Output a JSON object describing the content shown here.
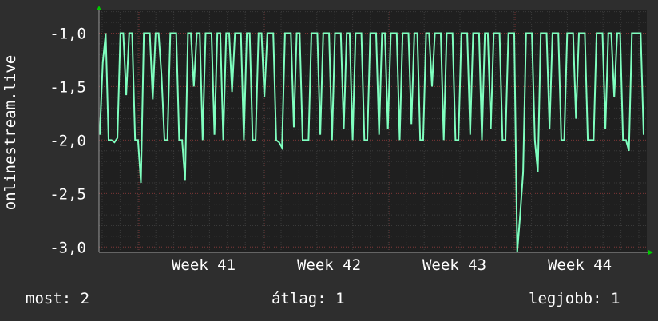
{
  "chart_data": {
    "type": "line",
    "ylabel": "onlinestream.live",
    "ylim": [
      -3.05,
      -0.78
    ],
    "yticks": [
      -1.0,
      -1.5,
      -2.0,
      -2.5,
      -3.0
    ],
    "ytick_labels": [
      "-1,0",
      "-1,5",
      "-2,0",
      "-2,5",
      "-3,0"
    ],
    "xtick_labels": [
      "Week 41",
      "Week 42",
      "Week 43",
      "Week 44"
    ],
    "grid": true,
    "colors": {
      "background": "#2e2e2e",
      "plot_background": "#1f1f1f",
      "line": "#7fffbf",
      "grid_minor": "#3a3a3a",
      "grid_major": "#7a3333",
      "axis": "#999999",
      "arrow": "#00cc00"
    },
    "series": [
      {
        "values": [
          -1.95,
          -1.28,
          -1.0,
          -2.0,
          -2.0,
          -2.02,
          -1.98,
          -1.0,
          -1.0,
          -1.58,
          -1.0,
          -1.0,
          -2.0,
          -2.0,
          -2.4,
          -1.0,
          -1.0,
          -1.0,
          -1.62,
          -1.0,
          -1.0,
          -1.4,
          -2.0,
          -2.0,
          -1.0,
          -1.0,
          -1.0,
          -2.0,
          -2.0,
          -2.38,
          -1.0,
          -1.0,
          -1.5,
          -1.0,
          -1.0,
          -2.0,
          -1.0,
          -1.0,
          -1.0,
          -1.95,
          -1.0,
          -1.0,
          -2.0,
          -1.0,
          -1.0,
          -1.55,
          -1.0,
          -1.0,
          -1.0,
          -2.0,
          -1.0,
          -1.0,
          -2.0,
          -2.0,
          -1.0,
          -1.0,
          -1.6,
          -1.0,
          -1.0,
          -1.0,
          -2.0,
          -2.02,
          -2.07,
          -1.0,
          -1.0,
          -1.0,
          -1.88,
          -1.0,
          -1.0,
          -2.0,
          -2.0,
          -2.0,
          -1.0,
          -1.0,
          -1.0,
          -1.95,
          -1.0,
          -1.0,
          -1.0,
          -2.0,
          -1.0,
          -1.0,
          -1.0,
          -1.9,
          -1.0,
          -1.0,
          -2.0,
          -1.0,
          -1.0,
          -1.0,
          -2.0,
          -2.0,
          -1.0,
          -1.0,
          -1.0,
          -1.95,
          -1.0,
          -1.0,
          -1.9,
          -1.0,
          -1.0,
          -1.0,
          -2.0,
          -1.0,
          -1.0,
          -1.0,
          -1.85,
          -1.0,
          -1.0,
          -2.0,
          -2.0,
          -1.0,
          -1.0,
          -1.5,
          -1.0,
          -1.0,
          -1.0,
          -2.0,
          -1.0,
          -1.0,
          -1.0,
          -2.0,
          -2.0,
          -1.0,
          -1.0,
          -1.0,
          -1.95,
          -1.0,
          -1.0,
          -1.0,
          -2.0,
          -1.0,
          -1.0,
          -1.9,
          -1.0,
          -1.0,
          -1.0,
          -2.0,
          -2.0,
          -1.0,
          -1.0,
          -1.0,
          -3.05,
          -2.7,
          -2.3,
          -1.0,
          -1.0,
          -1.0,
          -2.0,
          -2.3,
          -1.0,
          -1.0,
          -1.0,
          -1.9,
          -1.0,
          -1.0,
          -1.0,
          -2.0,
          -2.0,
          -1.0,
          -1.0,
          -1.0,
          -1.8,
          -1.0,
          -1.0,
          -1.0,
          -2.0,
          -2.0,
          -2.0,
          -1.0,
          -1.0,
          -1.0,
          -1.9,
          -1.0,
          -1.0,
          -1.6,
          -1.0,
          -1.0,
          -2.0,
          -2.0,
          -2.1,
          -1.0,
          -1.0,
          -1.0,
          -1.0,
          -1.95
        ]
      }
    ]
  },
  "legend": {
    "now": "most: 2",
    "avg": "átlag: 1",
    "best": "legjobb: 1"
  }
}
